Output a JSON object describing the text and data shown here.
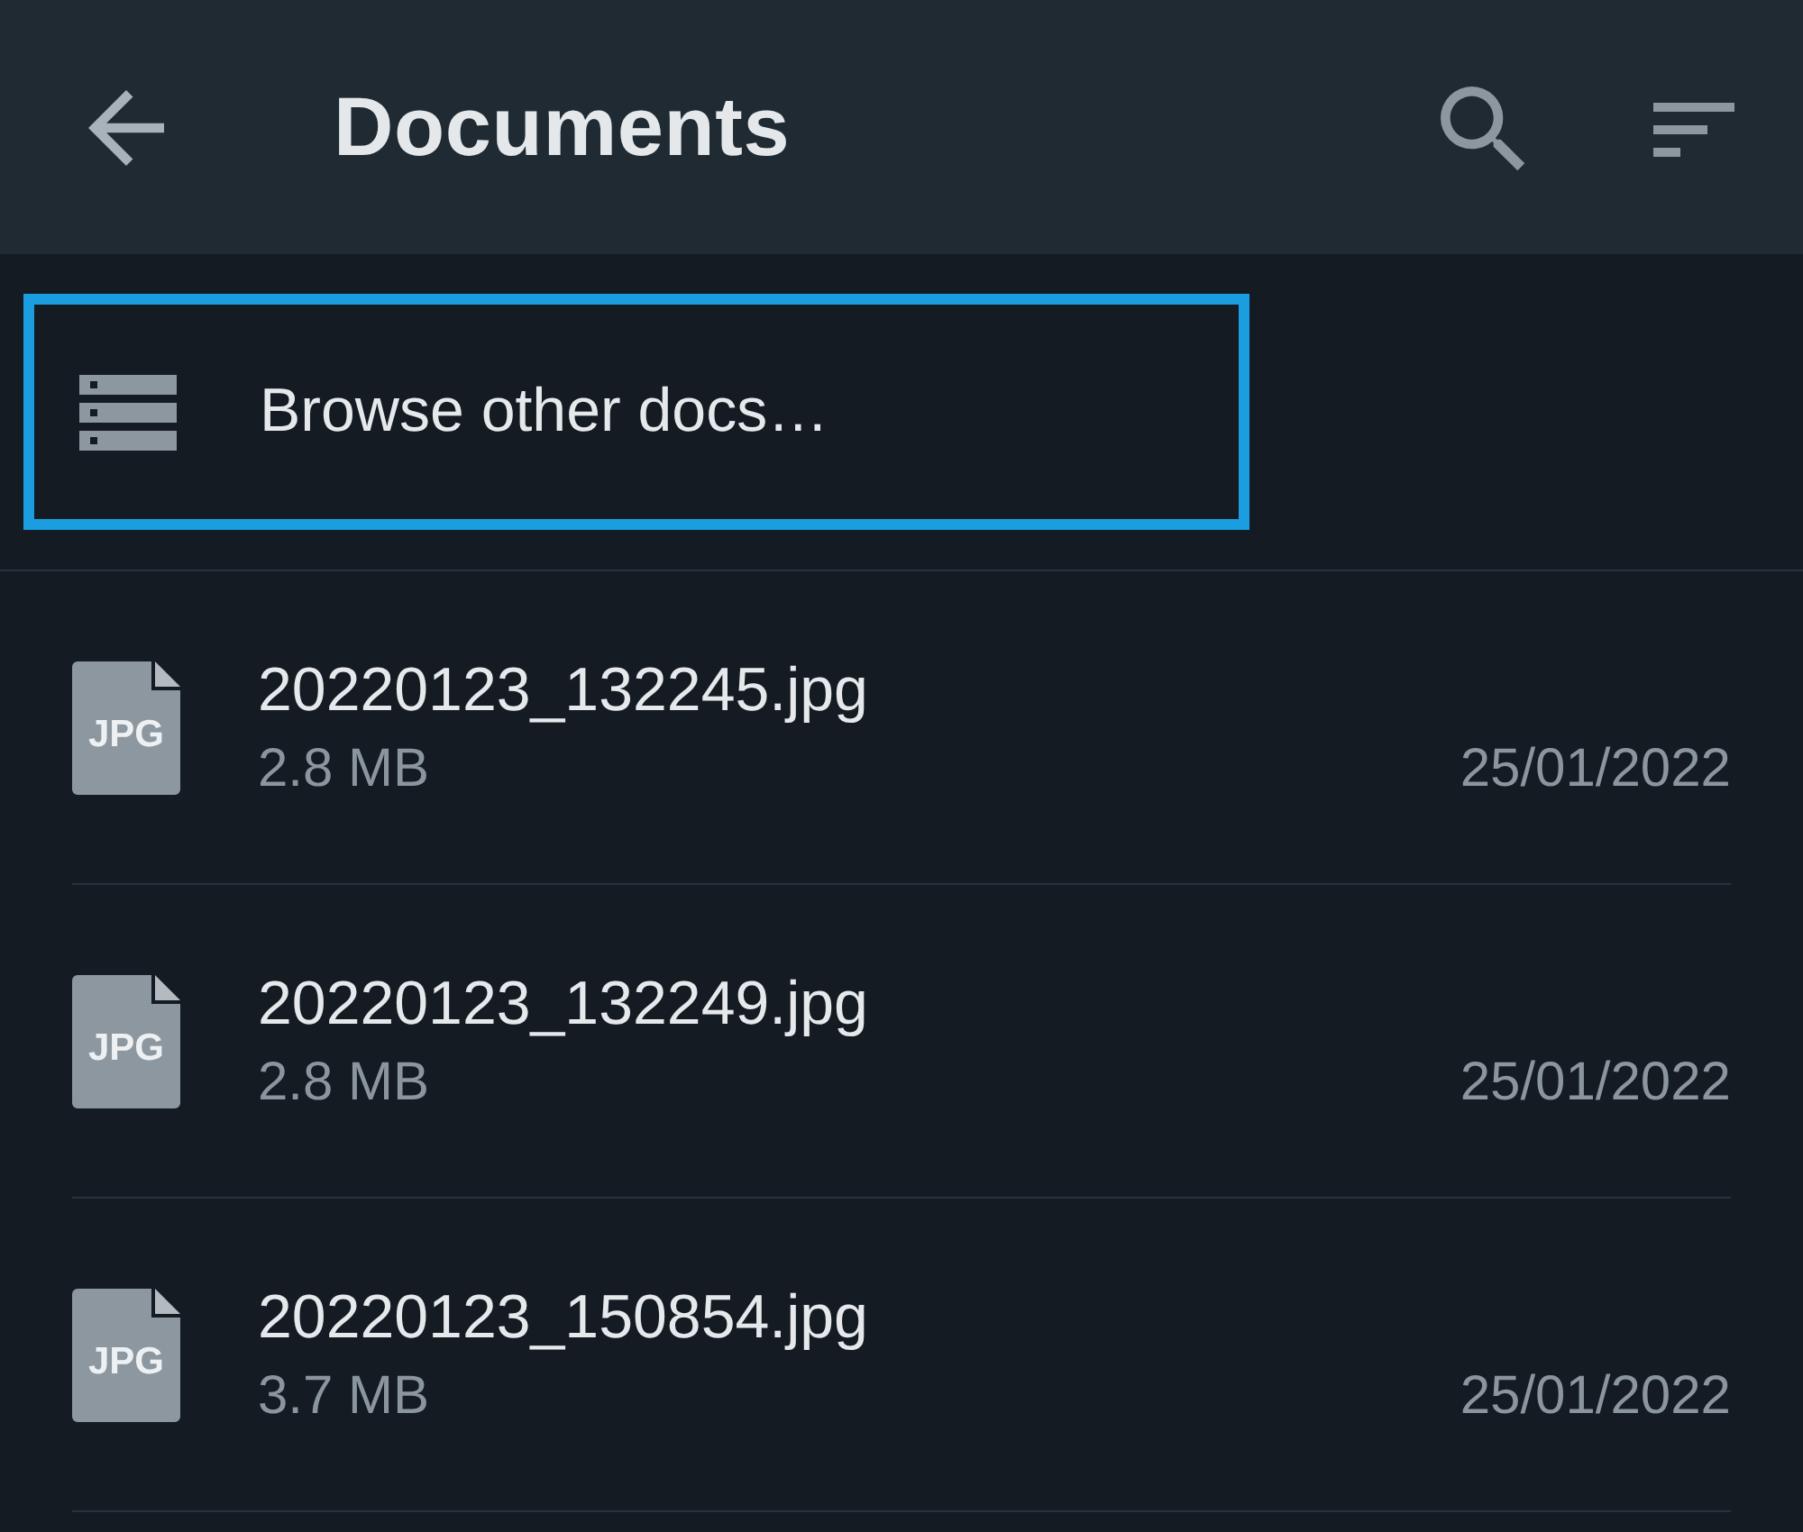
{
  "header": {
    "title": "Documents"
  },
  "browse_row": {
    "label": "Browse other docs…",
    "highlighted": true
  },
  "files": [
    {
      "name": "20220123_132245.jpg",
      "type_label": "JPG",
      "size": "2.8 MB",
      "date": "25/01/2022"
    },
    {
      "name": "20220123_132249.jpg",
      "type_label": "JPG",
      "size": "2.8 MB",
      "date": "25/01/2022"
    },
    {
      "name": "20220123_150854.jpg",
      "type_label": "JPG",
      "size": "3.7 MB",
      "date": "25/01/2022"
    }
  ]
}
